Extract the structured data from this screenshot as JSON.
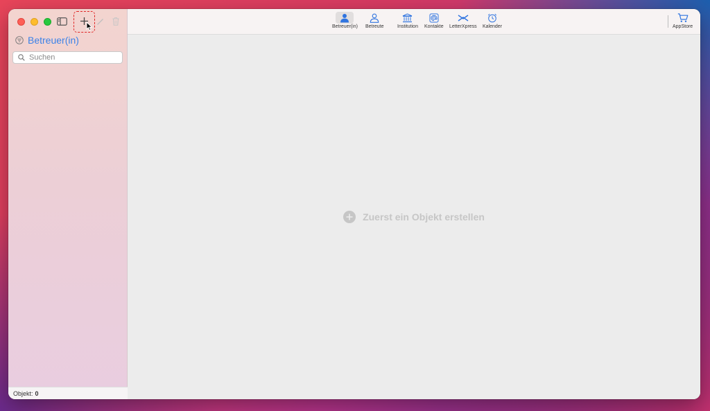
{
  "sidebar": {
    "section_title": "Betreuer(in)",
    "search_placeholder": "Suchen",
    "footer_label": "Objekt:",
    "footer_count": "0"
  },
  "toolbar": {
    "items": [
      {
        "label": "Betreuer(in)",
        "icon": "person-filled-icon",
        "active": true
      },
      {
        "label": "Betreute",
        "icon": "person-outline-icon",
        "active": false
      },
      {
        "label": "Institution",
        "icon": "bank-icon",
        "active": false
      },
      {
        "label": "Kontakte",
        "icon": "at-book-icon",
        "active": false
      },
      {
        "label": "LetterXpress",
        "icon": "letterxpress-icon",
        "active": false
      },
      {
        "label": "Kalender",
        "icon": "alarm-clock-icon",
        "active": false
      }
    ],
    "appstore_label": "AppStore"
  },
  "main": {
    "empty_message": "Zuerst ein Objekt erstellen"
  },
  "colors": {
    "accent": "#3b82e8",
    "highlight": "#e02424"
  }
}
